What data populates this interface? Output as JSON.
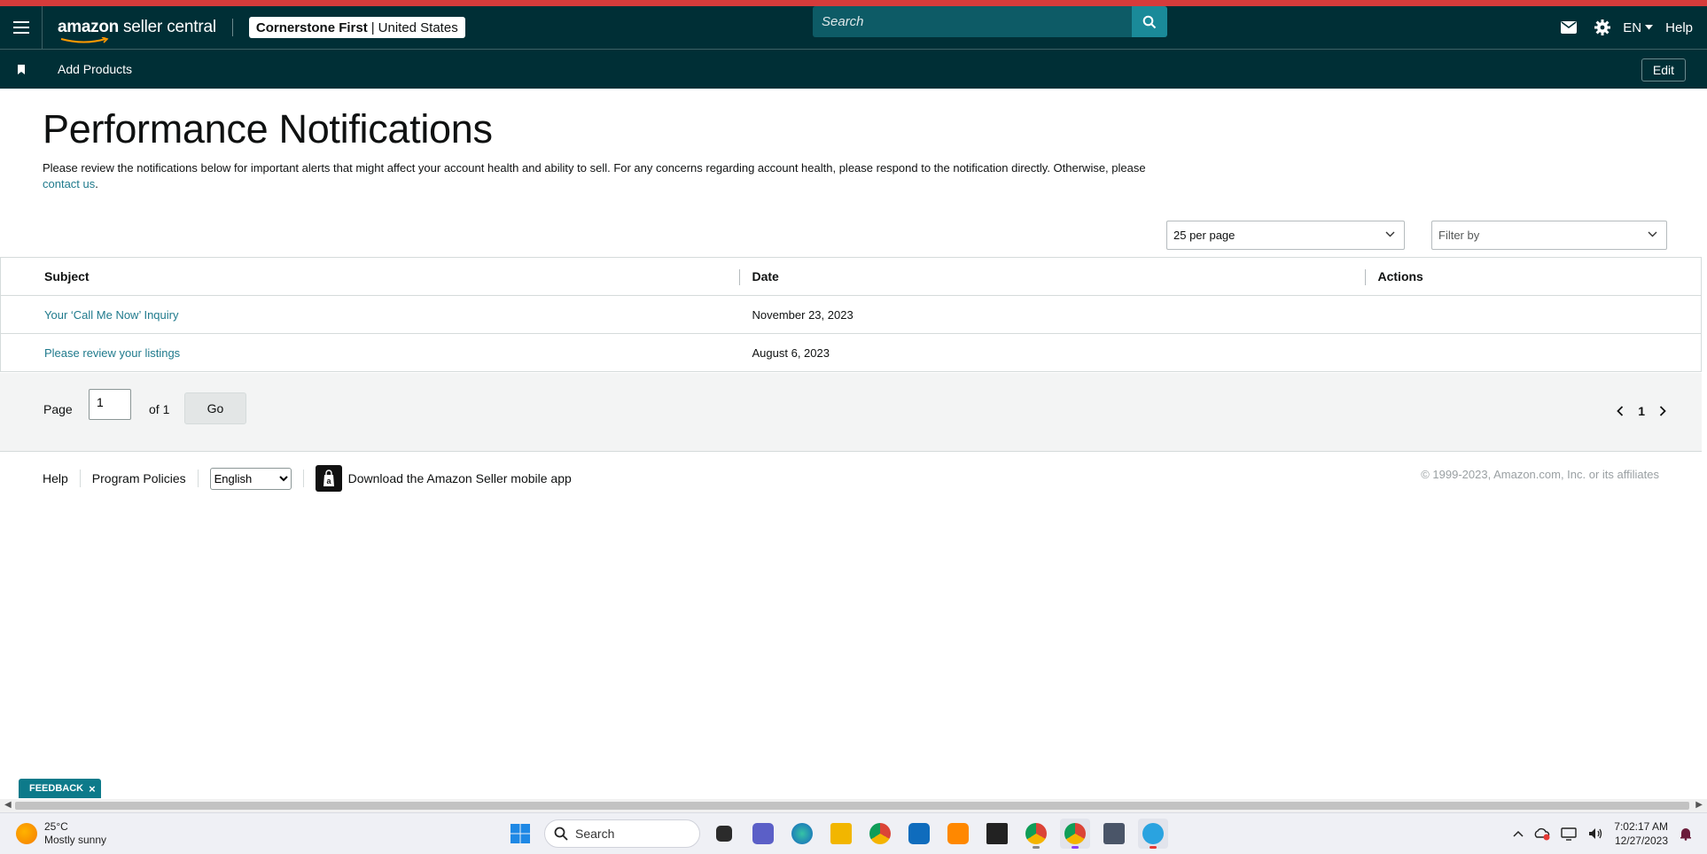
{
  "header": {
    "logo_bold": "amazon",
    "logo_rest": "seller central",
    "account_name": "Cornerstone First",
    "account_sep": "|",
    "account_region": "United States",
    "search_placeholder": "Search",
    "language": "EN",
    "help": "Help"
  },
  "subnav": {
    "add_products": "Add Products",
    "edit": "Edit"
  },
  "main": {
    "title": "Performance Notifications",
    "intro_text": "Please review the notifications below for important alerts that might affect your account health and ability to sell. For any concerns regarding account health, please respond to the notification directly. Otherwise, please",
    "intro_link": "contact us",
    "intro_end": ".",
    "per_page": "25 per page",
    "filter_placeholder": "Filter by"
  },
  "table": {
    "columns": [
      "Subject",
      "Date",
      "Actions"
    ],
    "rows": [
      {
        "subject": "Your ‘Call Me Now’ Inquiry",
        "date": "November 23, 2023",
        "actions": ""
      },
      {
        "subject": "Please review your listings",
        "date": "August 6, 2023",
        "actions": ""
      }
    ]
  },
  "pager": {
    "page_label": "Page",
    "page_value": "1",
    "of_label": "of 1",
    "go": "Go",
    "current": "1"
  },
  "footer": {
    "help": "Help",
    "program_policies": "Program Policies",
    "language_selected": "English",
    "app_download": "Download the Amazon Seller mobile app",
    "copyright": "© 1999-2023, Amazon.com, Inc. or its affiliates"
  },
  "feedback": {
    "label": "FEEDBACK",
    "close": "×"
  },
  "taskbar": {
    "temperature": "25°C",
    "weather": "Mostly sunny",
    "search": "Search",
    "time": "7:02:17 AM",
    "date": "12/27/2023"
  },
  "colors": {
    "nav_bg": "#002f36",
    "accent_red": "#d63b3b",
    "link": "#1f7a8c",
    "search_btn": "#1a8a99"
  }
}
